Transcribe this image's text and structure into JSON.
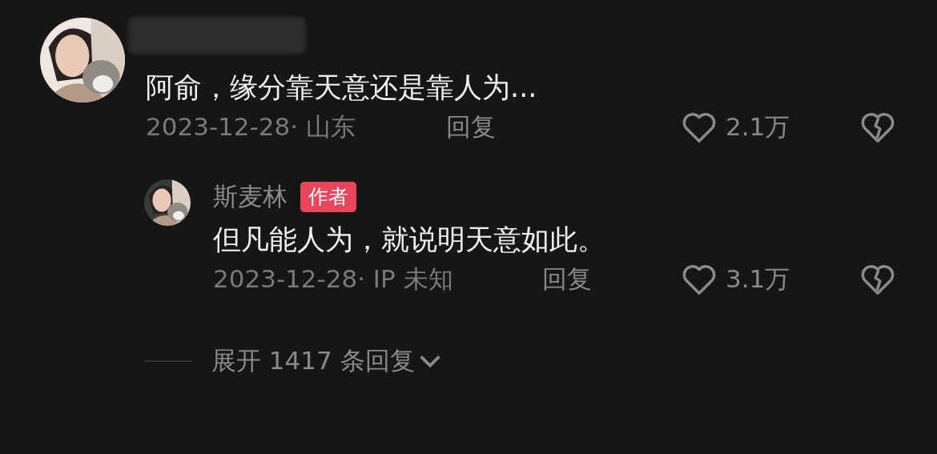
{
  "comment": {
    "author": {
      "redacted": true
    },
    "text": "阿俞，缘分靠天意还是靠人为...",
    "date_location": "2023-12-28· 山东",
    "reply_label": "回复",
    "liked": false,
    "like_count": "2.1万",
    "replies": [
      {
        "author": {
          "name": "斯麦林",
          "badge": "作者"
        },
        "text": "但凡能人为，就说明天意如此。",
        "date_location": "2023-12-28· IP 未知",
        "reply_label": "回复",
        "liked": false,
        "like_count": "3.1万"
      }
    ]
  },
  "expand": {
    "label": "展开 1417 条回复"
  }
}
